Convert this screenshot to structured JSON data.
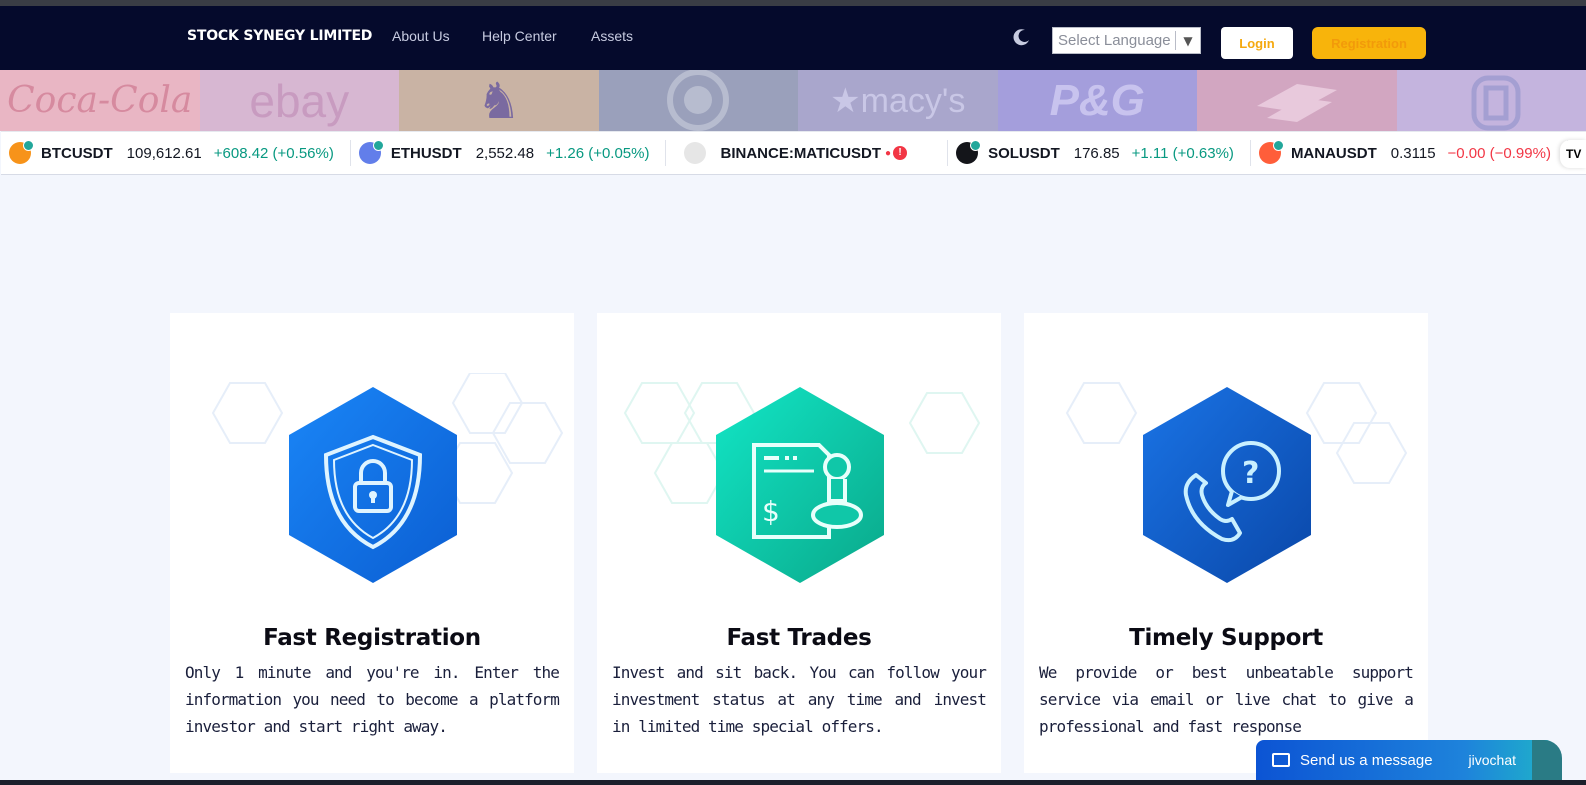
{
  "nav": {
    "brand": "STOCK SYNEGY LIMITED",
    "links": [
      "About Us",
      "Help Center",
      "Assets"
    ],
    "language_select": "Select Language",
    "login_label": "Login",
    "register_label": "Registration"
  },
  "brand_tiles": [
    {
      "text": "Coca-Cola",
      "bg": "#e9b6c4",
      "color": "#d68a9f"
    },
    {
      "text": "ebay",
      "bg": "#d7b7d2",
      "color": "#c89bc0"
    },
    {
      "text": "♞",
      "bg": "#c9b3a4",
      "color": "#7a6aa0"
    },
    {
      "text": "",
      "bg": "#9aa0bb",
      "color": "#b7bccf"
    },
    {
      "text": "★macy's",
      "bg": "#a9a6cc",
      "color": "#c9c7e6"
    },
    {
      "text": "P&G",
      "bg": "#a49edc",
      "color": "#c8c3ee"
    },
    {
      "text": "",
      "bg": "#d2a6c1",
      "color": "#e8c9dc"
    },
    {
      "text": "",
      "bg": "#c4b4de",
      "color": "#a49fd2"
    }
  ],
  "ticker": [
    {
      "symbol": "BTCUSDT",
      "price": "109,612.61",
      "change": "+608.42 (+0.56%)",
      "direction": "up",
      "coin_color": "#f7931a"
    },
    {
      "symbol": "ETHUSDT",
      "price": "2,552.48",
      "change": "+1.26 (+0.05%)",
      "direction": "up",
      "coin_color": "#627eea"
    },
    {
      "symbol": "BINANCE:MATICUSDT",
      "price": "",
      "change": "",
      "direction": "warn",
      "coin_color": "#e6e6e6"
    },
    {
      "symbol": "SOLUSDT",
      "price": "176.85",
      "change": "+1.11 (+0.63%)",
      "direction": "up",
      "coin_color": "#14151a"
    },
    {
      "symbol": "MANAUSDT",
      "price": "0.3115",
      "change": "−0.00 (−0.99%)",
      "direction": "down",
      "coin_color": "#ff5e3a"
    }
  ],
  "features": [
    {
      "title": "Fast Registration",
      "description": "Only 1 minute and you're in. Enter the information you need to become a platform investor and start right away.",
      "icon": "shield-lock-icon",
      "color_top": "#1a7ff5",
      "color_bottom": "#0b5ed2"
    },
    {
      "title": "Fast Trades",
      "description": "Invest and sit back. You can follow your investment status at any time and invest in limited time special offers.",
      "icon": "document-stamp-icon",
      "color_top": "#0fe0c1",
      "color_bottom": "#0aa88a"
    },
    {
      "title": "Timely Support",
      "description": "We provide or best unbeatable support service via email or live chat to give a professional and fast response",
      "icon": "phone-support-icon",
      "color_top": "#1a6fe0",
      "color_bottom": "#0a47a8"
    }
  ],
  "chat_widget": {
    "label": "Send us a message",
    "brand": "jivochat"
  }
}
